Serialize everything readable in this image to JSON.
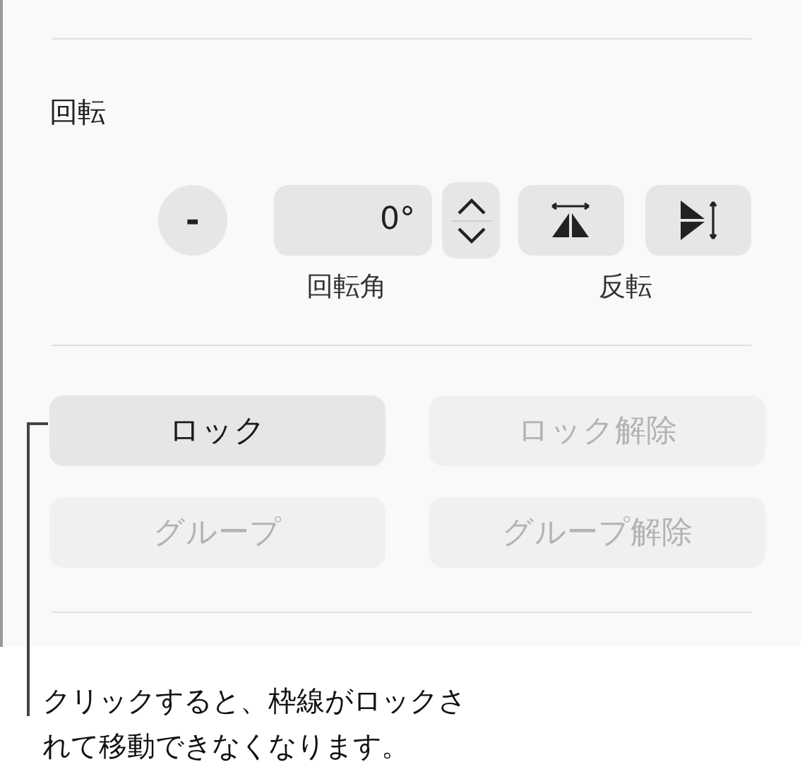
{
  "rotation": {
    "heading": "回転",
    "minus_button": "-",
    "angle_field": {
      "value": "0°"
    },
    "angle_label": "回転角",
    "flip_label": "反転"
  },
  "buttons": [
    {
      "label": "ロック",
      "disabled": false
    },
    {
      "label": "ロック解除",
      "disabled": true
    },
    {
      "label": "グループ",
      "disabled": true
    },
    {
      "label": "グループ解除",
      "disabled": true
    }
  ],
  "callout": "クリックすると、枠線がロックされて移動できなくなります。"
}
